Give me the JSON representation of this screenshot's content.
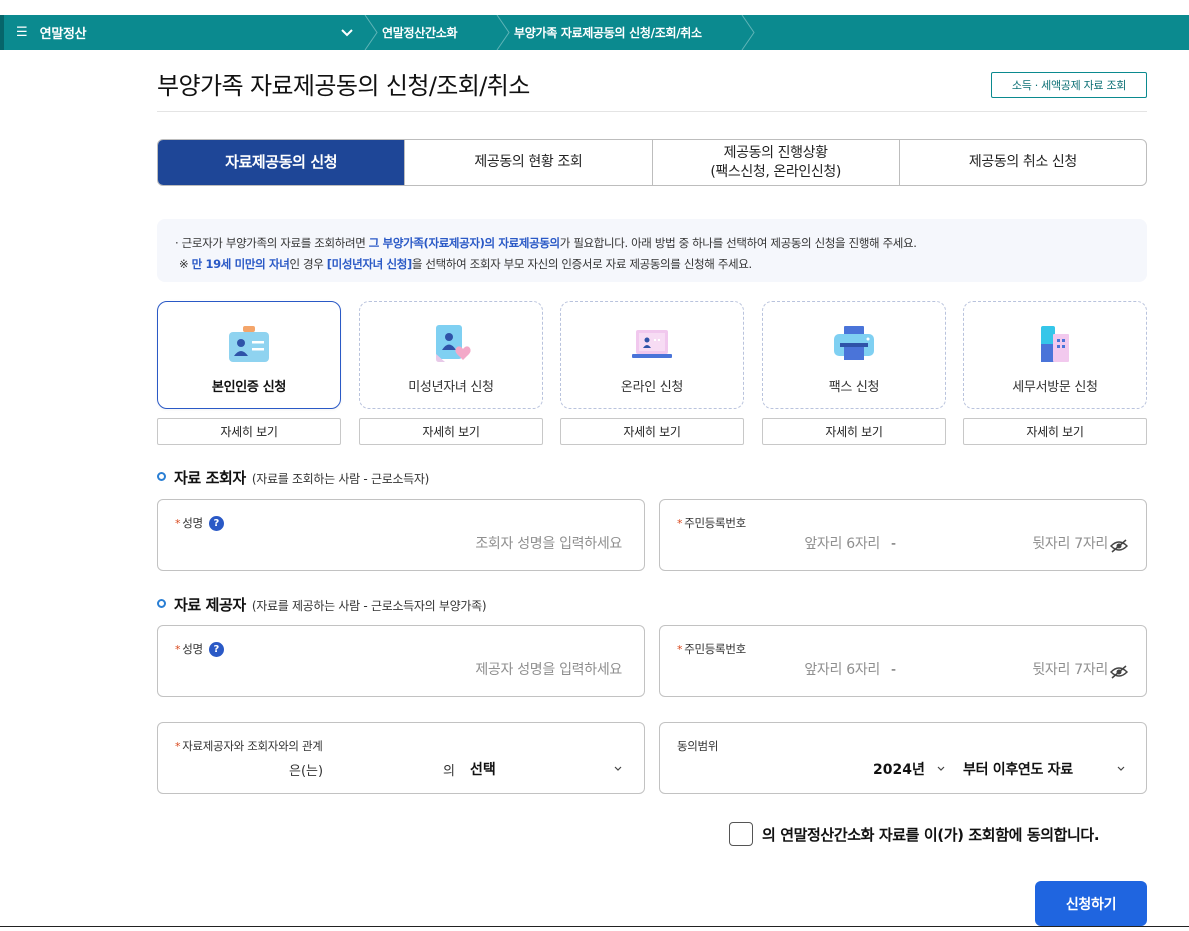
{
  "nav": {
    "menu_icon": "menu-icon",
    "title": "연말정산",
    "breadcrumbs": [
      "연말정산간소화",
      "부양가족 자료제공동의 신청/조회/취소"
    ],
    "colors": {
      "bar": "#0b8a8f"
    }
  },
  "header": {
    "title": "부양가족 자료제공동의 신청/조회/취소",
    "lookup_button": "소득 · 세액공제 자료 조회"
  },
  "tabs": [
    {
      "label": "자료제공동의 신청",
      "active": true
    },
    {
      "label": "제공동의 현황 조회",
      "active": false
    },
    {
      "label_line1": "제공동의 진행상황",
      "label_line2": "(팩스신청, 온라인신청)",
      "active": false
    },
    {
      "label": "제공동의 취소 신청",
      "active": false
    }
  ],
  "notice": {
    "line1_a": "· 근로자가 부양가족의 자료를 조회하려면 ",
    "line1_hl": "그 부양가족(자료제공자)의 자료제공동의",
    "line1_b": "가 필요합니다. 아래 방법 중 하나를 선택하여 제공동의 신청을 진행해 주세요.",
    "line2_a": "※ ",
    "line2_hl1": "만 19세 미만의 자녀",
    "line2_b": "인 경우 ",
    "line2_hl2": "[미성년자녀 신청]",
    "line2_c": "을 선택하여 조회자 부모 자신의 인증서로 자료 제공동의를 신청해 주세요."
  },
  "methods": [
    {
      "label": "본인인증 신청",
      "icon": "id-card-icon",
      "selected": true,
      "detail": "자세히 보기"
    },
    {
      "label": "미성년자녀 신청",
      "icon": "child-document-icon",
      "selected": false,
      "detail": "자세히 보기"
    },
    {
      "label": "온라인 신청",
      "icon": "laptop-icon",
      "selected": false,
      "detail": "자세히 보기"
    },
    {
      "label": "팩스 신청",
      "icon": "fax-icon",
      "selected": false,
      "detail": "자세히 보기"
    },
    {
      "label": "세무서방문 신청",
      "icon": "tax-office-icon",
      "selected": false,
      "detail": "자세히 보기"
    }
  ],
  "viewer": {
    "title": "자료 조회자",
    "subtitle": "(자료를 조회하는 사람 - 근로소득자)",
    "name_label": "성명",
    "name_placeholder": "조회자 성명을 입력하세요",
    "rrn_label": "주민등록번호",
    "rrn_front_placeholder": "앞자리 6자리",
    "rrn_back_placeholder": "뒷자리 7자리"
  },
  "provider": {
    "title": "자료 제공자",
    "subtitle": "(자료를 제공하는 사람 - 근로소득자의 부양가족)",
    "name_label": "성명",
    "name_placeholder": "제공자 성명을 입력하세요",
    "rrn_label": "주민등록번호",
    "rrn_front_placeholder": "앞자리 6자리",
    "rrn_back_placeholder": "뒷자리 7자리"
  },
  "relation": {
    "label": "자료제공자와 조회자와의 관계",
    "eun": "은(는)",
    "ui": "의",
    "selected": "선택"
  },
  "range": {
    "label": "동의범위",
    "year": "2024년",
    "after": "부터 이후연도 자료"
  },
  "common": {
    "req_mark": "*",
    "qmark": "?",
    "dash": "-"
  },
  "consent": {
    "text": "의 연말정산간소화 자료를 이(가) 조회함에 동의합니다."
  },
  "submit": {
    "label": "신청하기"
  }
}
